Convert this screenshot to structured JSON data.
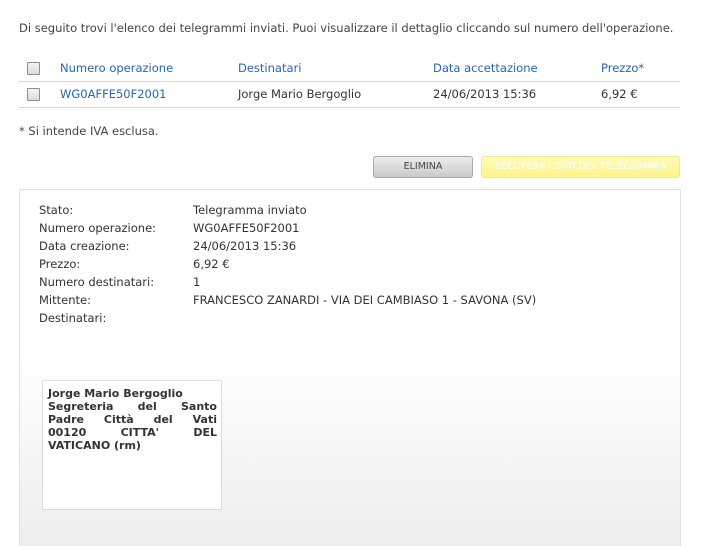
{
  "intro": "Di seguito trovi l'elenco dei telegrammi inviati. Puoi visualizzare il dettaglio cliccando sul numero dell'operazione.",
  "table": {
    "headers": [
      "Numero operazione",
      "Destinatari",
      "Data accettazione",
      "Prezzo*"
    ],
    "rows": [
      {
        "numero": "WG0AFFE50F2001",
        "destinatari": "Jorge Mario Bergoglio",
        "data": "24/06/2013 15:36",
        "prezzo": "6,92 €"
      }
    ]
  },
  "note": "* Si intende IVA esclusa.",
  "buttons": {
    "elimina": "ELIMINA",
    "recupera": "RECUPERA I DATI DEL TELEGRAMMA"
  },
  "detail": {
    "fields": [
      {
        "label": "Stato:",
        "value": "Telegramma inviato"
      },
      {
        "label": "Numero operazione:",
        "value": "WG0AFFE50F2001"
      },
      {
        "label": "Data creazione:",
        "value": "24/06/2013 15:36"
      },
      {
        "label": "Prezzo:",
        "value": "6,92 €"
      },
      {
        "label": "Numero destinatari:",
        "value": "1"
      },
      {
        "label": "Mittente:",
        "value": "FRANCESCO ZANARDI - VIA DEI CAMBIASO 1 - SAVONA (SV)"
      },
      {
        "label": "Destinatari:",
        "value": ""
      }
    ],
    "address_lines": [
      "Jorge Mario Bergoglio",
      "Segreteria del Santo",
      "Padre Città del Vati",
      "00120 CITTA' DEL",
      "VATICANO (rm)"
    ]
  },
  "colors": {
    "link": "#2a66a8",
    "recupera_bg": "#fff38a"
  }
}
